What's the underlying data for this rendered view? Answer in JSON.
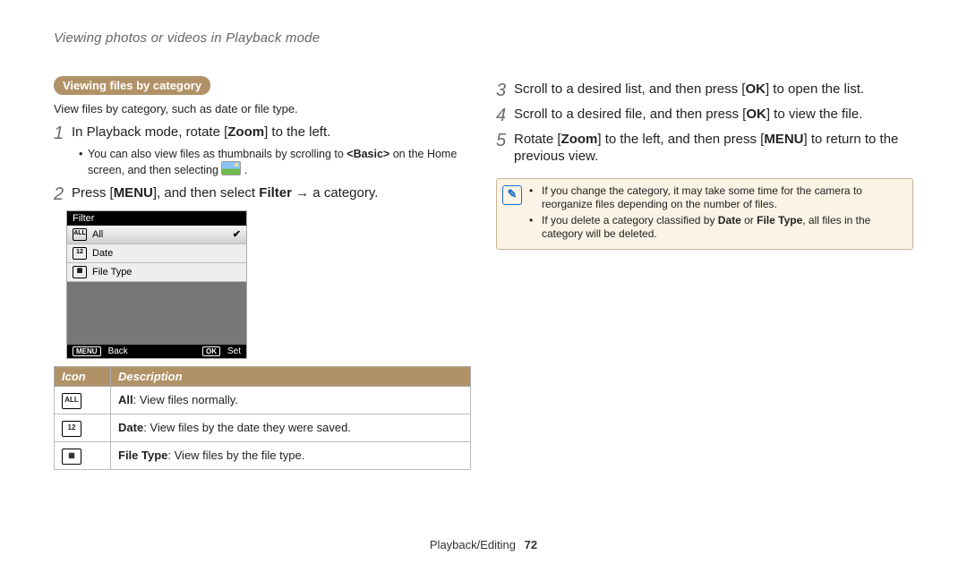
{
  "header": "Viewing photos or videos in Playback mode",
  "section_pill": "Viewing files by category",
  "section_desc": "View files by category, such as date or file type.",
  "steps_left": {
    "s1": "In Playback mode, rotate [",
    "s1_kw": "Zoom",
    "s1_end": "] to the left.",
    "s1_sub_a": "You can also view files as thumbnails by scrolling to ",
    "s1_sub_b": "<Basic>",
    "s1_sub_c": " on the Home screen, and then selecting ",
    "s2_a": "Press [",
    "s2_menu": "MENU",
    "s2_b": "], and then select ",
    "s2_filter": "Filter",
    "s2_c": " → a category."
  },
  "screen": {
    "title": "Filter",
    "row_all": "All",
    "row_date": "Date",
    "row_filetype": "File Type",
    "menu_btn": "MENU",
    "back": "Back",
    "ok_btn": "OK",
    "set": "Set"
  },
  "table": {
    "h_icon": "Icon",
    "h_desc": "Description",
    "r1_b": "All",
    "r1_t": ": View files normally.",
    "r2_b": "Date",
    "r2_t": ": View files by the date they were saved.",
    "r3_b": "File Type",
    "r3_t": ": View files by the file type."
  },
  "steps_right": {
    "s3_a": "Scroll to a desired list, and then press [",
    "ok": "OK",
    "s3_b": "] to open the list.",
    "s4_a": "Scroll to a desired file, and then press [",
    "s4_b": "] to view the file.",
    "s5_a": "Rotate [",
    "zoom": "Zoom",
    "s5_b": "] to the left, and then press [",
    "menu": "MENU",
    "s5_c": "] to return to the previous view."
  },
  "note": {
    "n1": "If you change the category, it may take some time for the camera to reorganize files depending on the number of files.",
    "n2_a": "If you delete a category classified by ",
    "n2_b": "Date",
    "n2_c": " or ",
    "n2_d": "File Type",
    "n2_e": ", all files in the category will be deleted."
  },
  "footer_label": "Playback/Editing",
  "footer_page": "72"
}
